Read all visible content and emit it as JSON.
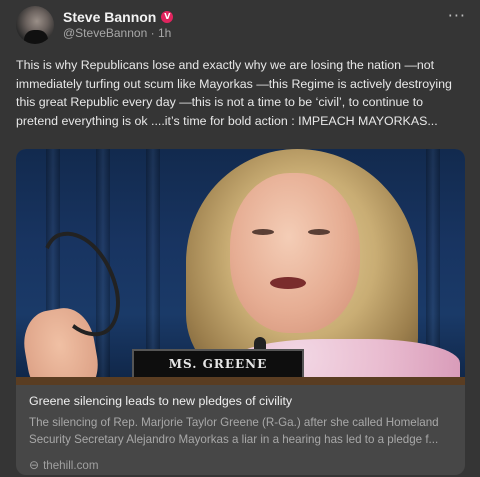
{
  "post": {
    "author": {
      "display_name": "Steve Bannon",
      "handle": "@SteveBannon",
      "time": "1h",
      "verified_badge": "V",
      "verified_color": "#e0245e"
    },
    "more_icon": "···",
    "text": "This is why Republicans lose and exactly why we are losing the nation —not immediately turfing out scum like Mayorkas —this Regime is actively destroying this great Republic every day —this is not a time to be ‘civil’, to continue to pretend everything is ok ....it’s time for bold action : IMPEACH MAYORKAS..."
  },
  "link_card": {
    "nameplate": "MS. GREENE",
    "title": "Greene silencing leads to new pledges of civility",
    "description": "The silencing of Rep. Marjorie Taylor Greene (R-Ga.) after she called Homeland Security Secretary Alejandro Mayorkas a liar in a hearing has led to a pledge f...",
    "domain": "thehill.com",
    "domain_icon": "link-icon"
  },
  "colors": {
    "background": "#353535",
    "card_background": "#474747"
  }
}
